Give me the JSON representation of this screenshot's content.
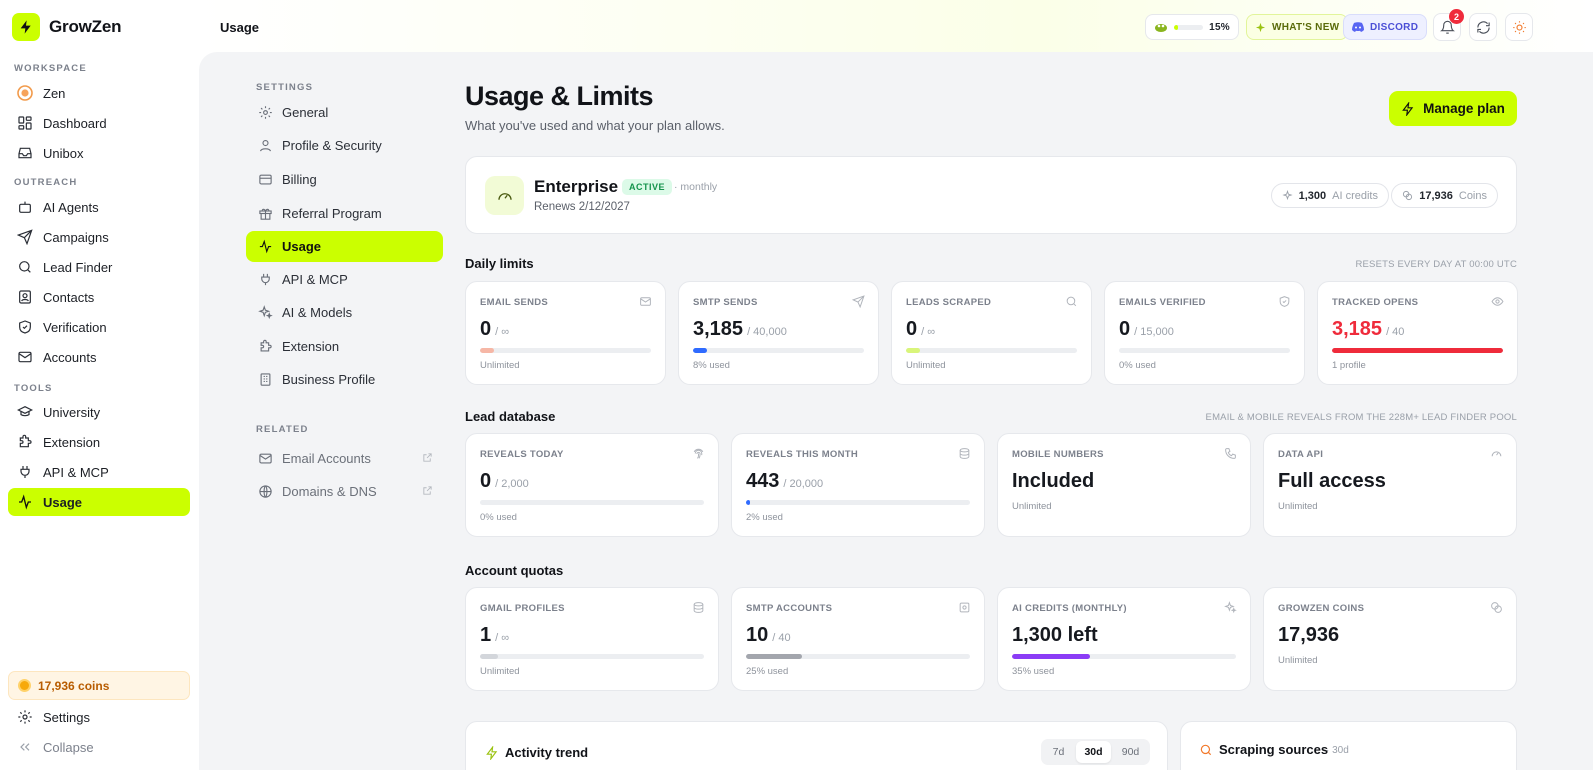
{
  "brand": {
    "name": "GrowZen"
  },
  "sidebar": {
    "sections": {
      "workspace": "WORKSPACE",
      "outreach": "OUTREACH",
      "tools": "TOOLS"
    },
    "items": [
      {
        "label": "Zen",
        "icon": "zen-orb-icon"
      },
      {
        "label": "Dashboard",
        "icon": "dashboard-icon"
      },
      {
        "label": "Unibox",
        "icon": "inbox-icon"
      },
      {
        "label": "AI Agents",
        "icon": "bot-icon"
      },
      {
        "label": "Campaigns",
        "icon": "send-icon"
      },
      {
        "label": "Lead Finder",
        "icon": "search-icon"
      },
      {
        "label": "Contacts",
        "icon": "contacts-icon"
      },
      {
        "label": "Verification",
        "icon": "shield-check-icon"
      },
      {
        "label": "Accounts",
        "icon": "mail-icon"
      },
      {
        "label": "University",
        "icon": "graduation-cap-icon"
      },
      {
        "label": "Extension",
        "icon": "puzzle-icon"
      },
      {
        "label": "API & MCP",
        "icon": "plug-icon"
      },
      {
        "label": "Usage",
        "icon": "activity-icon",
        "active": true
      }
    ],
    "coins": "17,936 coins",
    "settings": "Settings",
    "collapse": "Collapse"
  },
  "topbar": {
    "breadcrumb": "Usage",
    "progress_percent": "15%",
    "progress_value": 0.15,
    "whats_new": "WHAT'S NEW",
    "discord": "DISCORD",
    "notifications": "2"
  },
  "settings_nav": {
    "label": "SETTINGS",
    "items": [
      {
        "label": "General",
        "icon": "gear-icon"
      },
      {
        "label": "Profile & Security",
        "icon": "user-icon"
      },
      {
        "label": "Billing",
        "icon": "credit-card-icon"
      },
      {
        "label": "Referral Program",
        "icon": "gift-icon"
      },
      {
        "label": "Usage",
        "icon": "activity-icon",
        "active": true
      },
      {
        "label": "API & MCP",
        "icon": "plug-icon"
      },
      {
        "label": "AI & Models",
        "icon": "sparkles-icon"
      },
      {
        "label": "Extension",
        "icon": "puzzle-icon"
      },
      {
        "label": "Business Profile",
        "icon": "building-icon"
      }
    ],
    "related_label": "RELATED",
    "related": [
      {
        "label": "Email Accounts",
        "icon": "mail-icon"
      },
      {
        "label": "Domains & DNS",
        "icon": "globe-icon"
      }
    ]
  },
  "page": {
    "title": "Usage & Limits",
    "subtitle": "What you've used and what your plan allows.",
    "manage_plan": "Manage plan"
  },
  "plan": {
    "name": "Enterprise",
    "status": "ACTIVE",
    "period": "· monthly",
    "renews": "Renews 2/12/2027",
    "ai_credits_value": "1,300",
    "ai_credits_label": "AI credits",
    "coins_value": "17,936",
    "coins_label": "Coins"
  },
  "daily_limits": {
    "title": "Daily limits",
    "note": "RESETS EVERY DAY AT 00:00 UTC",
    "cards": [
      {
        "label": "EMAIL SENDS",
        "value": "0",
        "limit": "/ ∞",
        "fill": 0.08,
        "color": "#f6b7a6",
        "note": "Unlimited",
        "icon": "mail-icon"
      },
      {
        "label": "SMTP SENDS",
        "value": "3,185",
        "limit": "/ 40,000",
        "fill": 0.08,
        "color": "#2f6bff",
        "note": "8% used",
        "icon": "send-icon"
      },
      {
        "label": "LEADS SCRAPED",
        "value": "0",
        "limit": "/ ∞",
        "fill": 0.08,
        "color": "#d9f57a",
        "note": "Unlimited",
        "icon": "search-icon"
      },
      {
        "label": "EMAILS VERIFIED",
        "value": "0",
        "limit": "/ 15,000",
        "fill": 0.0,
        "color": "#c9ccd2",
        "note": "0% used",
        "icon": "shield-check-icon"
      },
      {
        "label": "TRACKED OPENS",
        "value": "3,185",
        "limit": "/ 40",
        "fill": 1.0,
        "color": "#ef2b3b",
        "note": "1 profile",
        "icon": "eye-icon",
        "red": true
      }
    ]
  },
  "lead_database": {
    "title": "Lead database",
    "note": "EMAIL & MOBILE REVEALS FROM THE 228M+ LEAD FINDER POOL",
    "cards": [
      {
        "label": "REVEALS TODAY",
        "value": "0",
        "limit": "/ 2,000",
        "fill": 0.0,
        "color": "#c9ccd2",
        "note": "0% used",
        "icon": "fingerprint-icon"
      },
      {
        "label": "REVEALS THIS MONTH",
        "value": "443",
        "limit": "/ 20,000",
        "fill": 0.02,
        "color": "#2f6bff",
        "note": "2% used",
        "icon": "database-icon"
      },
      {
        "label": "MOBILE NUMBERS",
        "value": "Included",
        "note": "Unlimited",
        "icon": "phone-icon"
      },
      {
        "label": "DATA API",
        "value": "Full access",
        "note": "Unlimited",
        "icon": "gauge-icon"
      }
    ]
  },
  "account_quotas": {
    "title": "Account quotas",
    "cards": [
      {
        "label": "GMAIL PROFILES",
        "value": "1",
        "limit": "/ ∞",
        "fill": 0.08,
        "color": "#d3d6db",
        "note": "Unlimited",
        "icon": "database-icon"
      },
      {
        "label": "SMTP ACCOUNTS",
        "value": "10",
        "limit": "/ 40",
        "fill": 0.25,
        "color": "#a3a6ad",
        "note": "25% used",
        "icon": "server-icon"
      },
      {
        "label": "AI CREDITS (MONTHLY)",
        "value": "1,300 left",
        "limit": "",
        "fill": 0.35,
        "color": "#8b3cf6",
        "note": "35% used",
        "icon": "sparkles-icon"
      },
      {
        "label": "GROWZEN COINS",
        "value": "17,936",
        "note": "Unlimited",
        "icon": "coins-icon"
      }
    ]
  },
  "activity": {
    "title": "Activity trend",
    "ranges": [
      "7d",
      "30d",
      "90d"
    ],
    "selected": "30d"
  },
  "scraping": {
    "title": "Scraping sources",
    "period": "· 30d"
  },
  "colors": {
    "accent": "#cbff00",
    "danger": "#ef2b3b",
    "success": "#14934b"
  }
}
